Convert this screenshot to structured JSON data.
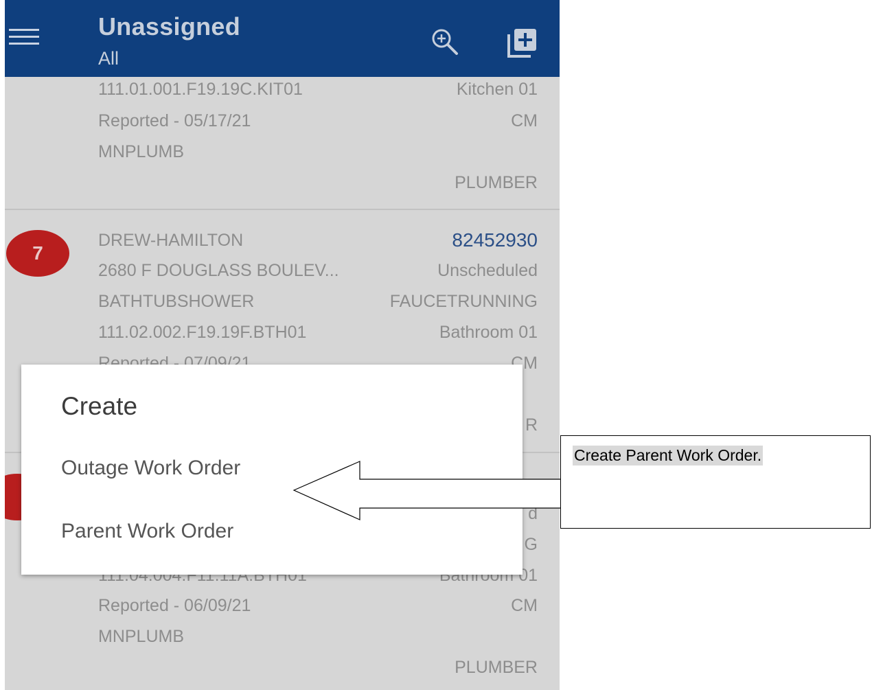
{
  "appbar": {
    "title": "Unassigned",
    "subtitle": "All",
    "icons": [
      "menu-icon",
      "zoom-in-icon",
      "add-library-icon"
    ]
  },
  "work_orders": [
    {
      "partial": true,
      "location_code": "111.01.001.F19.19C.KIT01",
      "location_name": "Kitchen 01",
      "reported": "Reported - 05/17/21",
      "type": "CM",
      "crew": "MNPLUMB",
      "trade": "PLUMBER"
    },
    {
      "badge": "7",
      "property": "DREW-HAMILTON",
      "number": "82452930",
      "address": "2680 F DOUGLASS BOULEV...",
      "status": "Unscheduled",
      "problem": "BATHTUBSHOWER",
      "subproblem": "FAUCETRUNNING",
      "location_code": "111.02.002.F19.19F.BTH01",
      "location_name": "Bathroom 01",
      "reported": "Reported - 07/09/21",
      "type": "CM",
      "trade_tail": "R"
    },
    {
      "status_tail": "d",
      "subproblem_tail": "G",
      "location_code": "111.04.004.F11.11A.BTH01",
      "location_name": "Bathroom 01",
      "reported": "Reported - 06/09/21",
      "type": "CM",
      "crew": "MNPLUMB",
      "trade": "PLUMBER"
    }
  ],
  "dialog": {
    "title": "Create",
    "options": [
      "Outage Work Order",
      "Parent Work Order"
    ]
  },
  "callout": {
    "text": "Create Parent Work Order."
  }
}
